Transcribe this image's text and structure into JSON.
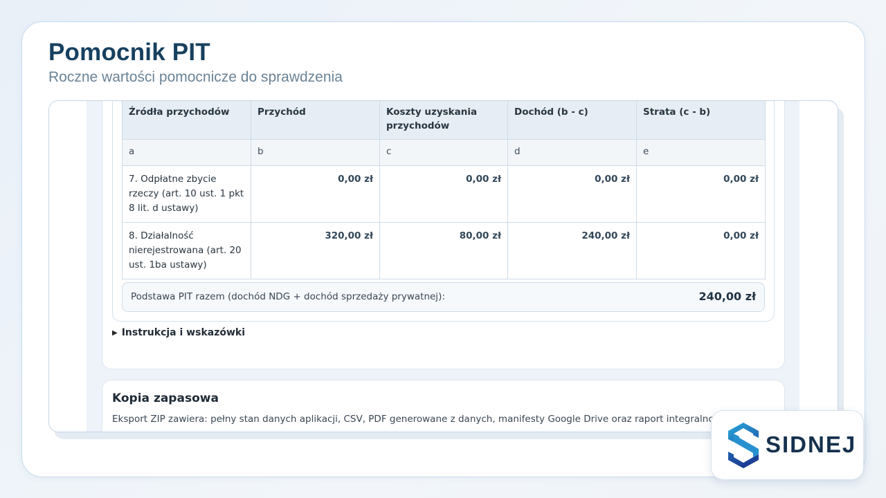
{
  "slide": {
    "title": "Pomocnik PIT",
    "subtitle": "Roczne wartości pomocnicze do sprawdzenia"
  },
  "income_table": {
    "headers": [
      "Źródła przychodów",
      "Przychód",
      "Koszty uzyskania przychodów",
      "Dochód (b - c)",
      "Strata (c - b)"
    ],
    "letters": [
      "a",
      "b",
      "c",
      "d",
      "e"
    ],
    "rows": [
      {
        "source": "7. Odpłatne zbycie rzeczy (art. 10 ust. 1 pkt 8 lit. d ustawy)",
        "przychod": "0,00 zł",
        "koszty": "0,00 zł",
        "dochod": "0,00 zł",
        "strata": "0,00 zł"
      },
      {
        "source": "8. Działalność nierejestrowana (art. 20 ust. 1ba ustawy)",
        "przychod": "320,00 zł",
        "koszty": "80,00 zł",
        "dochod": "240,00 zł",
        "strata": "0,00 zł"
      }
    ],
    "summary_label": "Podstawa PIT razem (dochód NDG + dochód sprzedaży prywatnej):",
    "summary_value": "240,00 zł"
  },
  "instructions": {
    "label": "Instrukcja i wskazówki"
  },
  "backup": {
    "title": "Kopia zapasowa",
    "description": "Eksport ZIP zawiera: pełny stan danych aplikacji, CSV, PDF generowane z danych, manifesty Google Drive oraz raport integralności danych."
  },
  "brand": {
    "name": "SIDNEJ",
    "colors": {
      "primary": "#17405f",
      "accent": "#2a9fd8",
      "dark": "#1c3c8c"
    }
  }
}
